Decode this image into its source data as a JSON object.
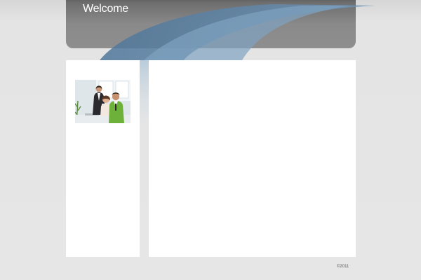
{
  "header": {
    "title": "Welcome"
  },
  "sidebar": {
    "image": "team-photo-image"
  },
  "footer": {
    "copyright": "©2011"
  },
  "colors": {
    "background": "#e6e6e6",
    "header_bar": "#8a8a8a",
    "swoosh_blue": "#5d84a6",
    "panel": "#ffffff",
    "title_text": "#ffffff"
  }
}
